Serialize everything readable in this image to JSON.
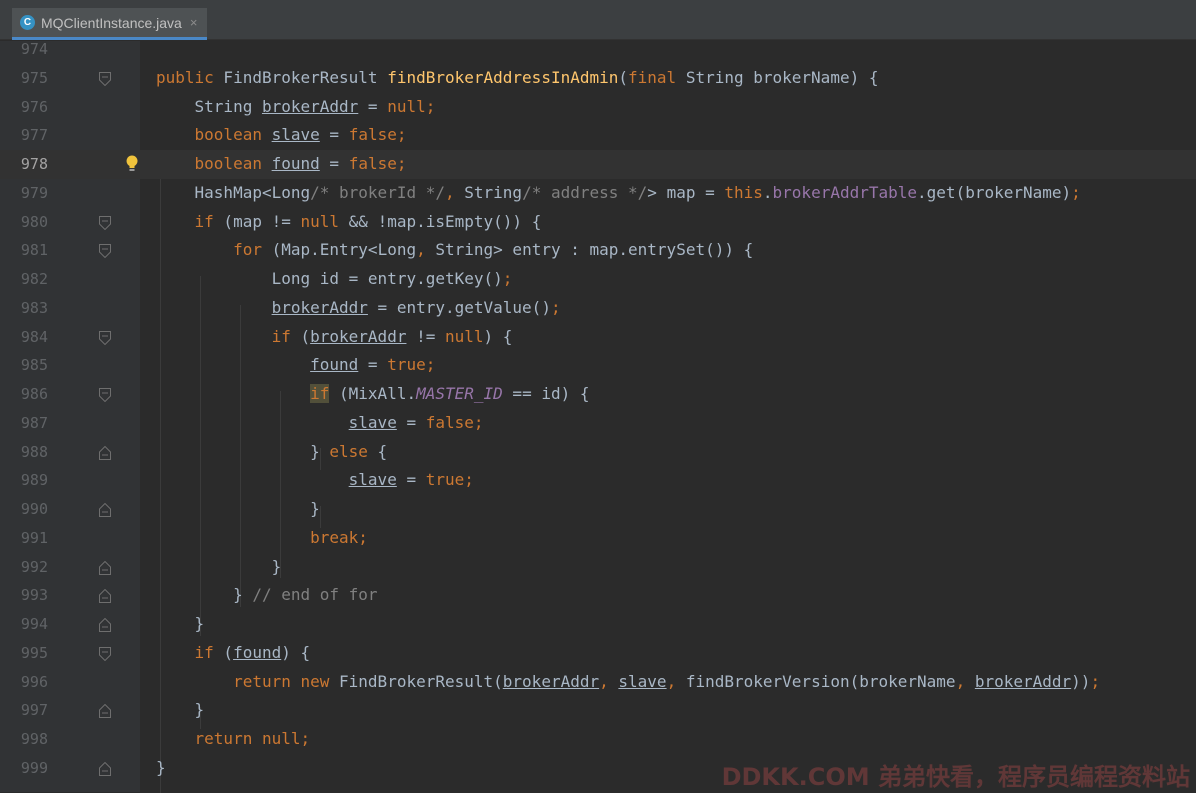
{
  "tab": {
    "icon_letter": "C",
    "title": "MQClientInstance.java",
    "close": "×"
  },
  "watermark": "DDKK.COM 弟弟快看，程序员编程资料站",
  "lines": [
    {
      "num": "974",
      "fold": null,
      "html": ""
    },
    {
      "num": "975",
      "fold": "open",
      "html": "<span class=\"kw\">public</span> FindBrokerResult <span class=\"fn\">findBrokerAddressInAdmin</span>(<span class=\"kw\">final</span> String brokerName) {"
    },
    {
      "num": "976",
      "fold": null,
      "html": "    String <span class=\"u\">brokerAddr</span> = <span class=\"kw\">null;</span>"
    },
    {
      "num": "977",
      "fold": null,
      "html": "    <span class=\"kw\">boolean</span> <span class=\"u\">slave</span> = <span class=\"kw\">false;</span>"
    },
    {
      "num": "978",
      "fold": null,
      "current": true,
      "bulb": true,
      "html": "    <span class=\"kw\">boolean</span> <span class=\"u\">found</span> = <span class=\"kw\">false;</span>"
    },
    {
      "num": "979",
      "fold": null,
      "html": "    HashMap&lt;Long<span class=\"cmt\">/* brokerId */</span><span class=\"kw\">,</span> String<span class=\"cmt\">/* address */</span>&gt; map = <span class=\"kw\">this</span>.<span class=\"fld\">brokerAddrTable</span>.get(brokerName)<span class=\"kw\">;</span>"
    },
    {
      "num": "980",
      "fold": "open",
      "html": "    <span class=\"kw\">if</span> (map != <span class=\"kw\">null</span> &amp;&amp; !map.isEmpty()) {"
    },
    {
      "num": "981",
      "fold": "open",
      "html": "        <span class=\"kw\">for</span> (Map.Entry&lt;Long<span class=\"kw\">,</span> String&gt; entry : map.entrySet()) {"
    },
    {
      "num": "982",
      "fold": null,
      "html": "            Long id = entry.getKey()<span class=\"kw\">;</span>"
    },
    {
      "num": "983",
      "fold": null,
      "html": "            <span class=\"u\">brokerAddr</span> = entry.getValue()<span class=\"kw\">;</span>"
    },
    {
      "num": "984",
      "fold": "open",
      "html": "            <span class=\"kw\">if</span> (<span class=\"u\">brokerAddr</span> != <span class=\"kw\">null</span>) {"
    },
    {
      "num": "985",
      "fold": null,
      "html": "                <span class=\"u\">found</span> = <span class=\"kw\">true;</span>"
    },
    {
      "num": "986",
      "fold": "open",
      "html": "                <span class=\"kw hl\">if</span> (MixAll.<span class=\"cst\">MASTER_ID</span> == id) {"
    },
    {
      "num": "987",
      "fold": null,
      "html": "                    <span class=\"u\">slave</span> = <span class=\"kw\">false;</span>"
    },
    {
      "num": "988",
      "fold": "close",
      "html": "                } <span class=\"kw\">else</span> {"
    },
    {
      "num": "989",
      "fold": null,
      "html": "                    <span class=\"u\">slave</span> = <span class=\"kw\">true;</span>"
    },
    {
      "num": "990",
      "fold": "close",
      "html": "                }"
    },
    {
      "num": "991",
      "fold": null,
      "html": "                <span class=\"kw\">break;</span>"
    },
    {
      "num": "992",
      "fold": "close",
      "html": "            }"
    },
    {
      "num": "993",
      "fold": "close",
      "html": "        } <span class=\"cmt\">// end of for</span>"
    },
    {
      "num": "994",
      "fold": "close",
      "html": "    }"
    },
    {
      "num": "995",
      "fold": "open",
      "html": "    <span class=\"kw\">if</span> (<span class=\"u\">found</span>) {"
    },
    {
      "num": "996",
      "fold": null,
      "html": "        <span class=\"kw\">return new</span> FindBrokerResult(<span class=\"u\">brokerAddr</span><span class=\"kw\">,</span> <span class=\"u\">slave</span><span class=\"kw\">,</span> findBrokerVersion(brokerName<span class=\"kw\">,</span> <span class=\"u\">brokerAddr</span>))<span class=\"kw\">;</span>"
    },
    {
      "num": "997",
      "fold": "close",
      "html": "    }"
    },
    {
      "num": "998",
      "fold": null,
      "html": "    <span class=\"kw\">return null;</span>"
    },
    {
      "num": "999",
      "fold": "close",
      "html": "}"
    }
  ]
}
